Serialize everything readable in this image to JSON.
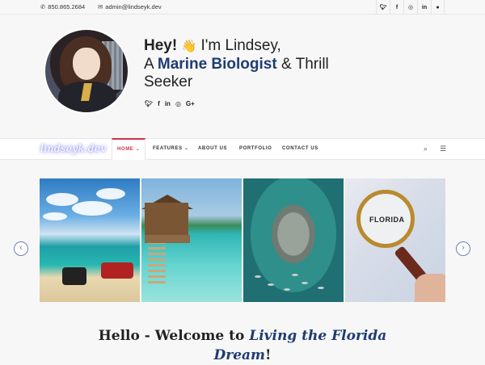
{
  "topbar": {
    "phone": "850.865.2684",
    "email": "admin@lindseyk.dev",
    "socials": [
      "twitter",
      "facebook",
      "instagram",
      "linkedin",
      "github"
    ]
  },
  "hero": {
    "hey": "Hey!",
    "wave": "👋",
    "intro": "I'm Lindsey,",
    "line2_prefix": "A",
    "role": "Marine Biologist",
    "line2_suffix": "& Thrill",
    "line3": "Seeker",
    "socials": [
      "twitter",
      "facebook",
      "linkedin",
      "instagram",
      "google-plus"
    ]
  },
  "nav": {
    "logo": "lindseyk.dev",
    "items": [
      "HOME",
      "FEATURES",
      "ABOUT US",
      "PORTFOLIO",
      "CONTACT US"
    ],
    "active": "HOME"
  },
  "gallery": {
    "map_label": "FLORIDA"
  },
  "welcome": {
    "prefix": "Hello - Welcome to",
    "emphasis": "Living the Florida",
    "emphasis2": "Dream",
    "suffix": "!"
  },
  "colors": {
    "accent_blue": "#1f3c73",
    "accent_red": "#d0314e",
    "background": "#f7f7f7"
  }
}
